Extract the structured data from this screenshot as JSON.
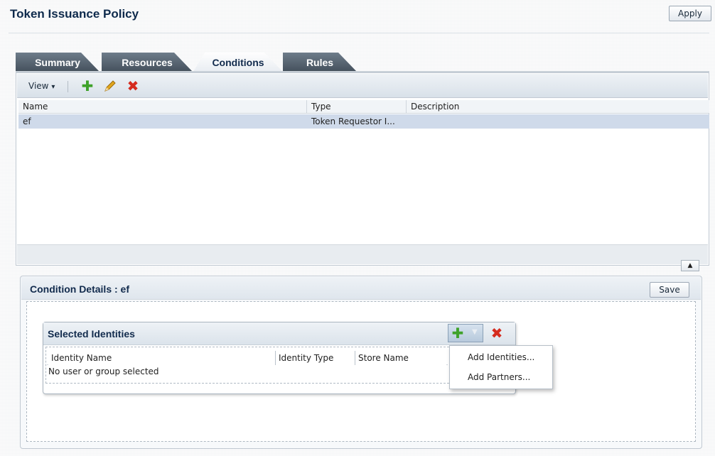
{
  "header": {
    "title": "Token Issuance Policy",
    "apply_label": "Apply"
  },
  "tabs": [
    {
      "label": "Summary",
      "active": false
    },
    {
      "label": "Resources",
      "active": false
    },
    {
      "label": "Conditions",
      "active": true
    },
    {
      "label": "Rules",
      "active": false
    }
  ],
  "toolbar": {
    "view_label": "View",
    "view_caret": "▾",
    "add_icon": "add-icon",
    "edit_icon": "edit-icon",
    "delete_icon": "delete-icon"
  },
  "conditions_table": {
    "columns": [
      "Name",
      "Type",
      "Description"
    ],
    "rows": [
      {
        "name": "ef",
        "type": "Token Requestor I...",
        "description": ""
      }
    ]
  },
  "details": {
    "title": "Condition Details : ef",
    "save_label": "Save"
  },
  "identities": {
    "title": "Selected Identities",
    "columns": [
      "Identity Name",
      "Identity Type",
      "Store Name"
    ],
    "empty_message": "No user or group selected",
    "menu_items": [
      "Add Identities...",
      "Add Partners..."
    ]
  },
  "colors": {
    "tab_dark": "#4a5663",
    "selected_row": "#cfdaea",
    "add_green": "#3fa22a",
    "delete_red": "#d52b1e"
  }
}
